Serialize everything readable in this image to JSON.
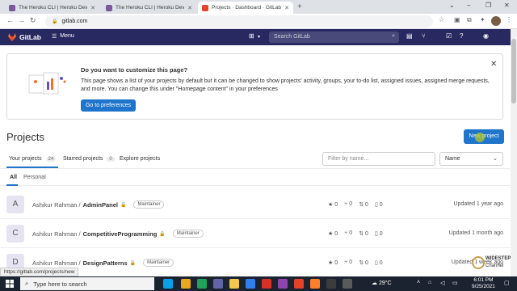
{
  "browser": {
    "tabs": [
      {
        "title": "The Heroku CLI | Heroku Dev Ce",
        "favicon_color": "#79589f",
        "active": false
      },
      {
        "title": "The Heroku CLI | Heroku Dev Ce",
        "favicon_color": "#79589f",
        "active": false
      },
      {
        "title": "Projects · Dashboard · GitLab",
        "favicon_color": "#e24329",
        "active": true
      }
    ],
    "new_tab": "+",
    "url": "gitlab.com",
    "status_url": "https://gitlab.com/projects/new"
  },
  "gitlab_header": {
    "title": "GitLab",
    "menu_label": "Menu",
    "search_placeholder": "Search GitLab"
  },
  "callout": {
    "title": "Do you want to customize this page?",
    "body": "This page shows a list of your projects by default but it can be changed to show projects' activity, groups, your to-do list, assigned issues, assigned merge requests, and more. You can change this under \"Homepage content\" in your preferences",
    "button": "Go to preferences"
  },
  "page": {
    "title": "Projects",
    "new_project_button": "New project"
  },
  "project_tabs": [
    {
      "label": "Your projects",
      "count": "24"
    },
    {
      "label": "Starred projects",
      "count": "0"
    },
    {
      "label": "Explore projects",
      "count": ""
    }
  ],
  "filter_placeholder": "Filter by name...",
  "sort_label": "Name",
  "sub_tabs": [
    "All",
    "Personal"
  ],
  "projects": [
    {
      "avatar": "A",
      "namespace": "Ashikur Rahman /",
      "name": "AdminPanel",
      "role": "Maintainer",
      "stars": "0",
      "forks": "0",
      "mrs": "0",
      "issues": "0",
      "updated": "Updated 1 year ago"
    },
    {
      "avatar": "C",
      "namespace": "Ashikur Rahman /",
      "name": "CompetitiveProgramming",
      "role": "Maintainer",
      "stars": "0",
      "forks": "0",
      "mrs": "0",
      "issues": "0",
      "updated": "Updated 1 month ago"
    },
    {
      "avatar": "D",
      "namespace": "Ashikur Rahman /",
      "name": "DesignPatterns",
      "role": "Maintainer",
      "stars": "0",
      "forks": "0",
      "mrs": "0",
      "issues": "0",
      "updated": "Updated 1 week ago"
    }
  ],
  "watermark": {
    "text": "WIDESTEP",
    "sub": "Channel"
  },
  "taskbar": {
    "search_placeholder": "Type here to search",
    "weather": "29°C",
    "time": "6:01 PM",
    "date": "9/25/2021"
  },
  "colors": {
    "gitlab_header": "#292961",
    "primary_button": "#1f75cb",
    "taskbar": "#1c2330"
  }
}
